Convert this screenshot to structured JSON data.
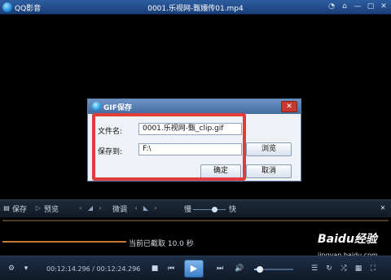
{
  "app": {
    "name": "QQ影音",
    "window_title": "0001.乐视网-甄嬛传01.mp4"
  },
  "window_controls": {
    "icons": [
      "skin-icon",
      "pin-icon",
      "minimize-icon",
      "maximize-icon",
      "close-icon"
    ]
  },
  "gif_dialog": {
    "title": "GIF保存",
    "filename_label": "文件名:",
    "filename_value": "0001.乐视网-甄_clip.gif",
    "savepath_label": "保存到:",
    "savepath_value": "F:\\",
    "browse_label": "浏览",
    "ok_label": "确定",
    "cancel_label": "取消",
    "close_glyph": "✕"
  },
  "toolbar": {
    "save_label": "保存",
    "preview_label": "预览",
    "fine_tune_label": "微调",
    "slow_label": "慢",
    "fast_label": "快",
    "speed_level": 0.65
  },
  "clip": {
    "status_text": "当前已截取 10.0 秒",
    "clip_fraction": 0.32
  },
  "playbar": {
    "time_text": "00:12:14.296 / 00:12:24.296",
    "play_glyph": "▶",
    "volume_level": 0.15
  },
  "watermark": {
    "logo_text": "Baidu经验",
    "url_text": "jingyan.baidu.com"
  }
}
